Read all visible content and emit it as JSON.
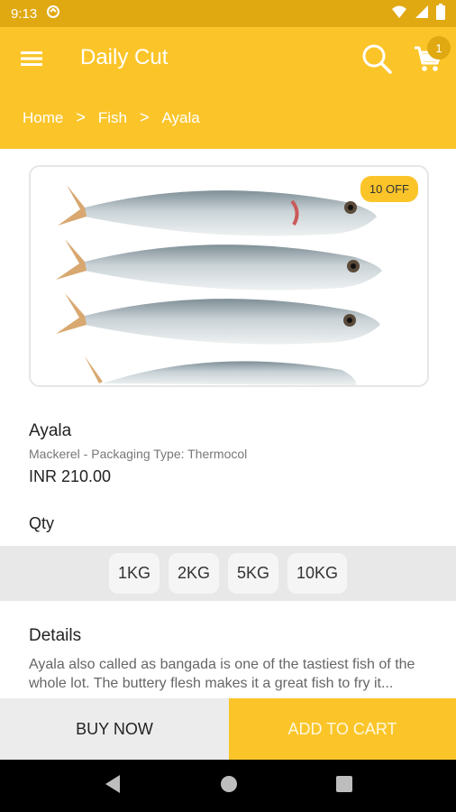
{
  "status": {
    "time": "9:13"
  },
  "appbar": {
    "title": "Daily Cut",
    "cart_count": "1"
  },
  "breadcrumb": {
    "items": [
      "Home",
      "Fish",
      "Ayala"
    ],
    "separator": ">"
  },
  "product": {
    "discount": "10 OFF",
    "name": "Ayala",
    "subtitle": "Mackerel - Packaging Type: Thermocol",
    "price": "INR 210.00"
  },
  "qty": {
    "label": "Qty",
    "options": [
      "1KG",
      "2KG",
      "5KG",
      "10KG"
    ]
  },
  "details": {
    "title": "Details",
    "text": "Ayala also called as bangada is one of the tastiest fish of the whole lot. The buttery flesh makes it a great fish to fry it..."
  },
  "actions": {
    "buy_now": "BUY NOW",
    "add_to_cart": "ADD TO CART"
  },
  "colors": {
    "primary": "#FBC52A",
    "status_bar": "#E0A912"
  }
}
